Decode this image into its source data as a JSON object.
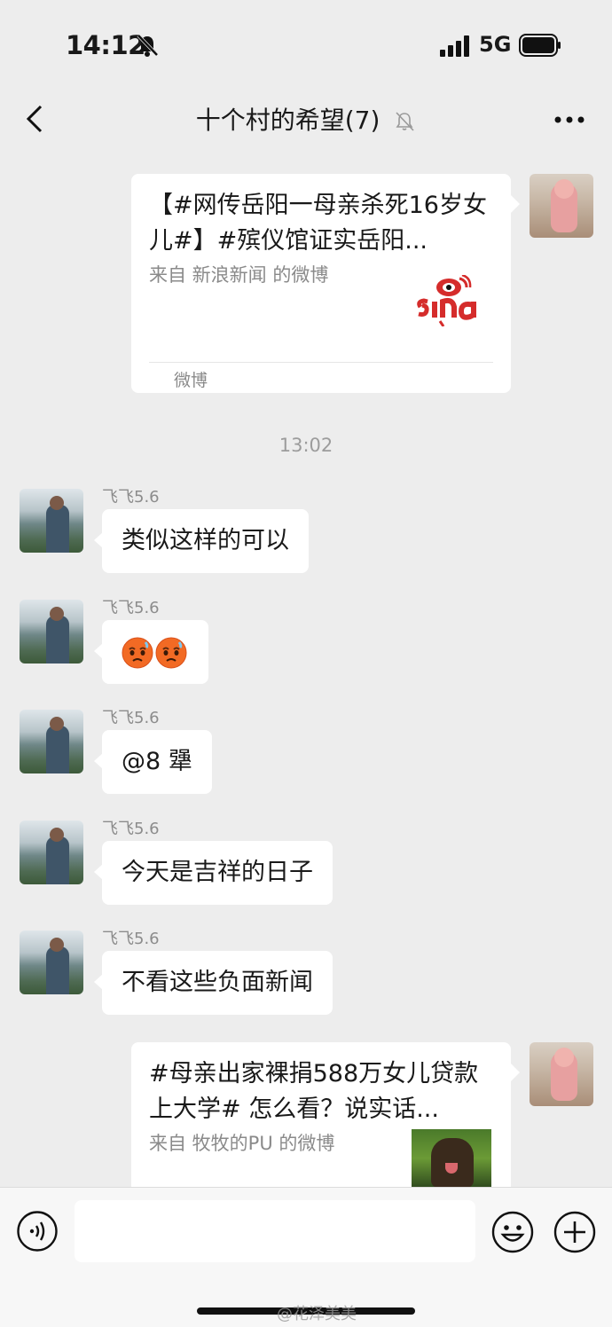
{
  "status_bar": {
    "time": "14:12",
    "network": "5G"
  },
  "chat": {
    "title": "十个村的希望(7)"
  },
  "messages_top": {
    "card1": {
      "title": "【#网传岳阳一母亲杀死16岁女儿#】#殡仪馆证实岳阳...",
      "source": "来自 新浪新闻 的微博",
      "footer": "微博",
      "logo": "sina-logo"
    },
    "timestamp": "13:02"
  },
  "incoming": [
    {
      "sender": "飞飞5.6",
      "text": "类似这样的可以"
    },
    {
      "sender": "飞飞5.6",
      "text": "",
      "emojis": [
        "tired-face-emoji",
        "tired-face-emoji"
      ]
    },
    {
      "sender": "飞飞5.6",
      "text": "@8 犟"
    },
    {
      "sender": "飞飞5.6",
      "text": "今天是吉祥的日子"
    },
    {
      "sender": "飞飞5.6",
      "text": "不看这些负面新闻"
    }
  ],
  "card2": {
    "title": "#母亲出家裸捐588万女儿贷款上大学# 怎么看？说实话...",
    "source": "来自 牧牧的PU 的微博"
  },
  "input": {
    "placeholder": ""
  },
  "watermark": "@花泽美美",
  "colors": {
    "background": "#ededed",
    "bubble": "#ffffff",
    "weibo_red": "#d52c2b",
    "meta_gray": "#8c8c8c"
  }
}
